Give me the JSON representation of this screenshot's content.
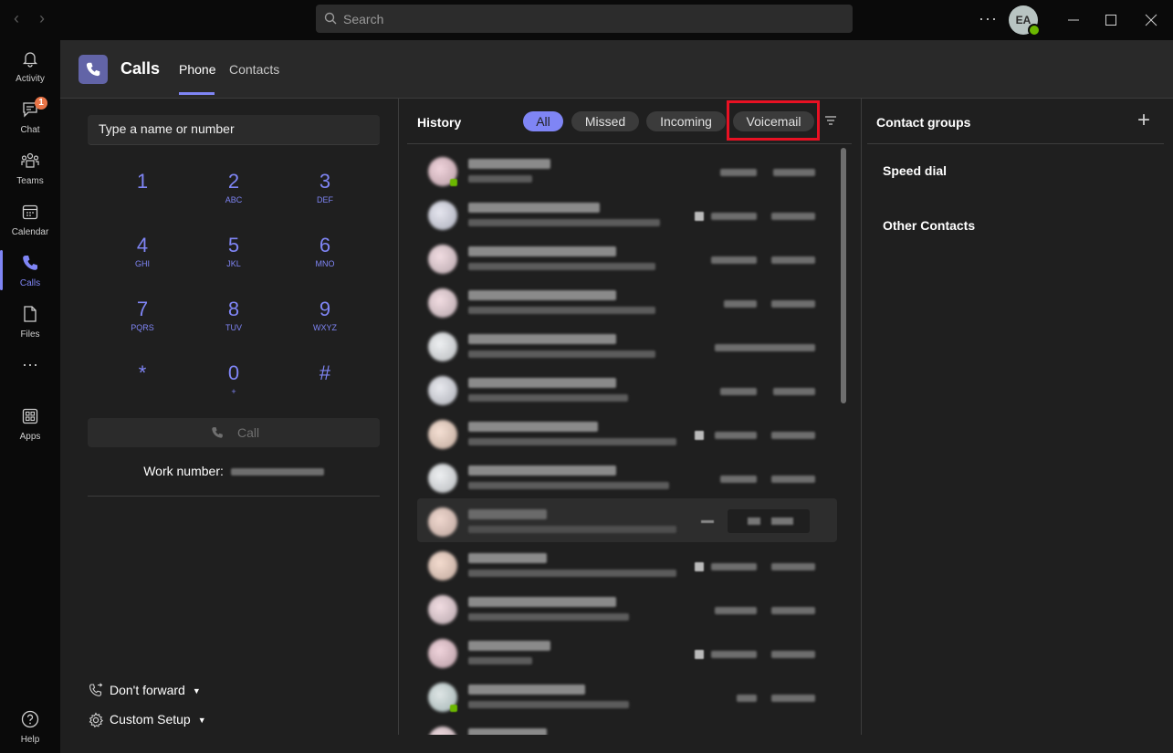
{
  "titlebar": {
    "search_placeholder": "Search",
    "avatar_initials": "EA",
    "more_label": "···"
  },
  "rail": {
    "items": [
      {
        "label": "Activity",
        "icon": "bell-icon"
      },
      {
        "label": "Chat",
        "icon": "chat-icon",
        "badge": "1"
      },
      {
        "label": "Teams",
        "icon": "teams-icon"
      },
      {
        "label": "Calendar",
        "icon": "calendar-icon"
      },
      {
        "label": "Calls",
        "icon": "phone-icon",
        "active": true
      },
      {
        "label": "Files",
        "icon": "file-icon"
      },
      {
        "label": "Apps",
        "icon": "apps-icon"
      },
      {
        "label": "Help",
        "icon": "help-icon"
      }
    ],
    "more_label": "···"
  },
  "header": {
    "title": "Calls",
    "tabs": [
      {
        "label": "Phone",
        "active": true
      },
      {
        "label": "Contacts",
        "active": false
      }
    ]
  },
  "dialpad": {
    "input_placeholder": "Type a name or number",
    "keys": [
      {
        "digit": "1",
        "letters": ""
      },
      {
        "digit": "2",
        "letters": "ABC"
      },
      {
        "digit": "3",
        "letters": "DEF"
      },
      {
        "digit": "4",
        "letters": "GHI"
      },
      {
        "digit": "5",
        "letters": "JKL"
      },
      {
        "digit": "6",
        "letters": "MNO"
      },
      {
        "digit": "7",
        "letters": "PQRS"
      },
      {
        "digit": "8",
        "letters": "TUV"
      },
      {
        "digit": "9",
        "letters": "WXYZ"
      },
      {
        "digit": "*",
        "letters": ""
      },
      {
        "digit": "0",
        "letters": "+"
      },
      {
        "digit": "#",
        "letters": ""
      }
    ],
    "call_label": "Call",
    "work_number_label": "Work number:",
    "forward_label": "Don't forward",
    "setup_label": "Custom Setup"
  },
  "history": {
    "title": "History",
    "filters": [
      {
        "label": "All",
        "active": true
      },
      {
        "label": "Missed",
        "active": false
      },
      {
        "label": "Incoming",
        "active": false
      },
      {
        "label": "Voicemail",
        "active": false,
        "highlighted": true
      }
    ],
    "entries_note": "Call history entries are pixelated/redacted in the screenshot"
  },
  "contact_groups": {
    "title": "Contact groups",
    "add_label": "+",
    "groups": [
      "Speed dial",
      "Other Contacts"
    ]
  },
  "colors": {
    "accent": "#7f85f5",
    "highlight_border": "#e81123",
    "presence_available": "#6bb700",
    "badge": "#e97548"
  }
}
